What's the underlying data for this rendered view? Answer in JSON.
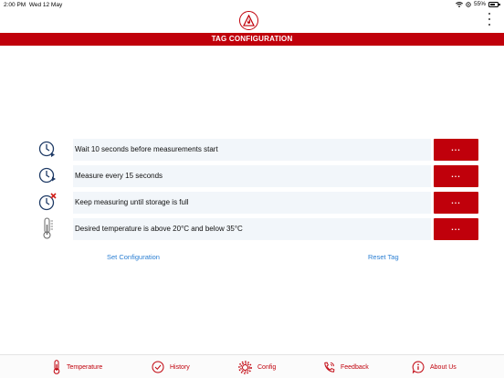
{
  "status_bar": {
    "time": "2:00 PM",
    "date": "Wed 12 May",
    "battery": "55%"
  },
  "header": {
    "title": "TAG CONFIGURATION",
    "logo": "flame-logo-icon",
    "menu_icon": "more-vertical-icon"
  },
  "config": {
    "items": [
      {
        "text": "Wait 10 seconds before measurements start",
        "icon": "clock-play-icon",
        "button": "..."
      },
      {
        "text": "Measure every 15 seconds",
        "icon": "clock-interval-icon",
        "button": "..."
      },
      {
        "text": "Keep measuring until storage is full",
        "icon": "clock-stop-icon",
        "button": "..."
      },
      {
        "text": "Desired temperature is above 20°C and below 35°C",
        "icon": "thermometer-icon",
        "button": "..."
      }
    ],
    "set_label": "Set Configuration",
    "reset_label": "Reset Tag"
  },
  "tabs": [
    {
      "label": "Temperature",
      "icon": "thermometer-icon"
    },
    {
      "label": "History",
      "icon": "history-icon"
    },
    {
      "label": "Config",
      "icon": "gear-icon"
    },
    {
      "label": "Feedback",
      "icon": "phone-icon"
    },
    {
      "label": "About Us",
      "icon": "info-icon"
    }
  ],
  "colors": {
    "brand_red": "#c0000b",
    "link_blue": "#2b7fd3",
    "row_bg": "#f2f6fa"
  }
}
